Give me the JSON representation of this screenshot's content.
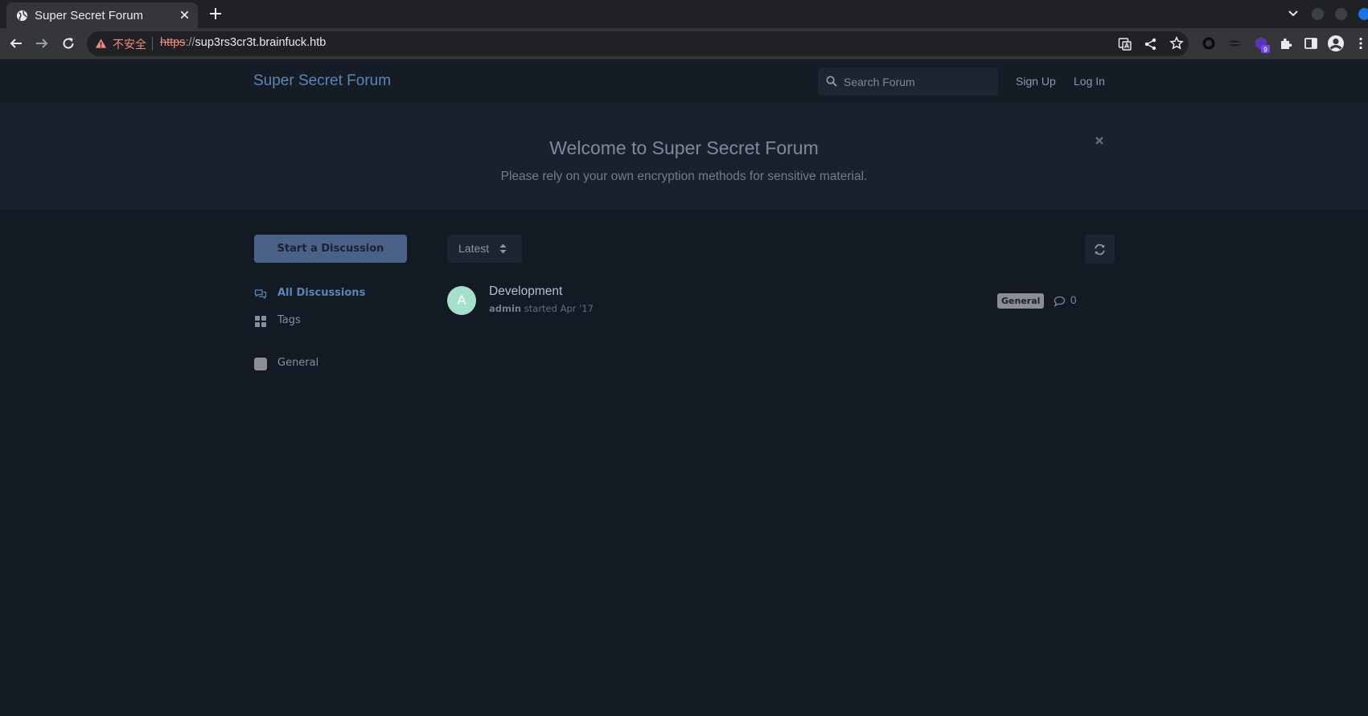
{
  "browser": {
    "tab_title": "Super Secret Forum",
    "security_label": "不安全",
    "url_scheme": "https",
    "url_sep": "://",
    "url_host": "sup3rs3cr3t.brainfuck.htb",
    "extension_badge": "9"
  },
  "header": {
    "site_title": "Super Secret Forum",
    "search_placeholder": "Search Forum",
    "signup_label": "Sign Up",
    "login_label": "Log In"
  },
  "hero": {
    "title": "Welcome to Super Secret Forum",
    "description": "Please rely on your own encryption methods for sensitive material."
  },
  "sidebar": {
    "start_label": "Start a Discussion",
    "nav": [
      {
        "label": "All Discussions",
        "icon": "comments-icon",
        "active": true
      },
      {
        "label": "Tags",
        "icon": "grid-icon",
        "active": false
      }
    ],
    "tags": [
      {
        "label": "General",
        "color": "#8b8f95"
      }
    ]
  },
  "list": {
    "sort_label": "Latest",
    "discussions": [
      {
        "avatar_letter": "A",
        "avatar_color": "#a5e0cc",
        "title": "Development",
        "author": "admin",
        "meta_text": " started Apr '17",
        "tag": "General",
        "replies": "0"
      }
    ]
  },
  "colors": {
    "accent": "#5a86b5",
    "button": "#4a6288",
    "background": "#141a24"
  }
}
